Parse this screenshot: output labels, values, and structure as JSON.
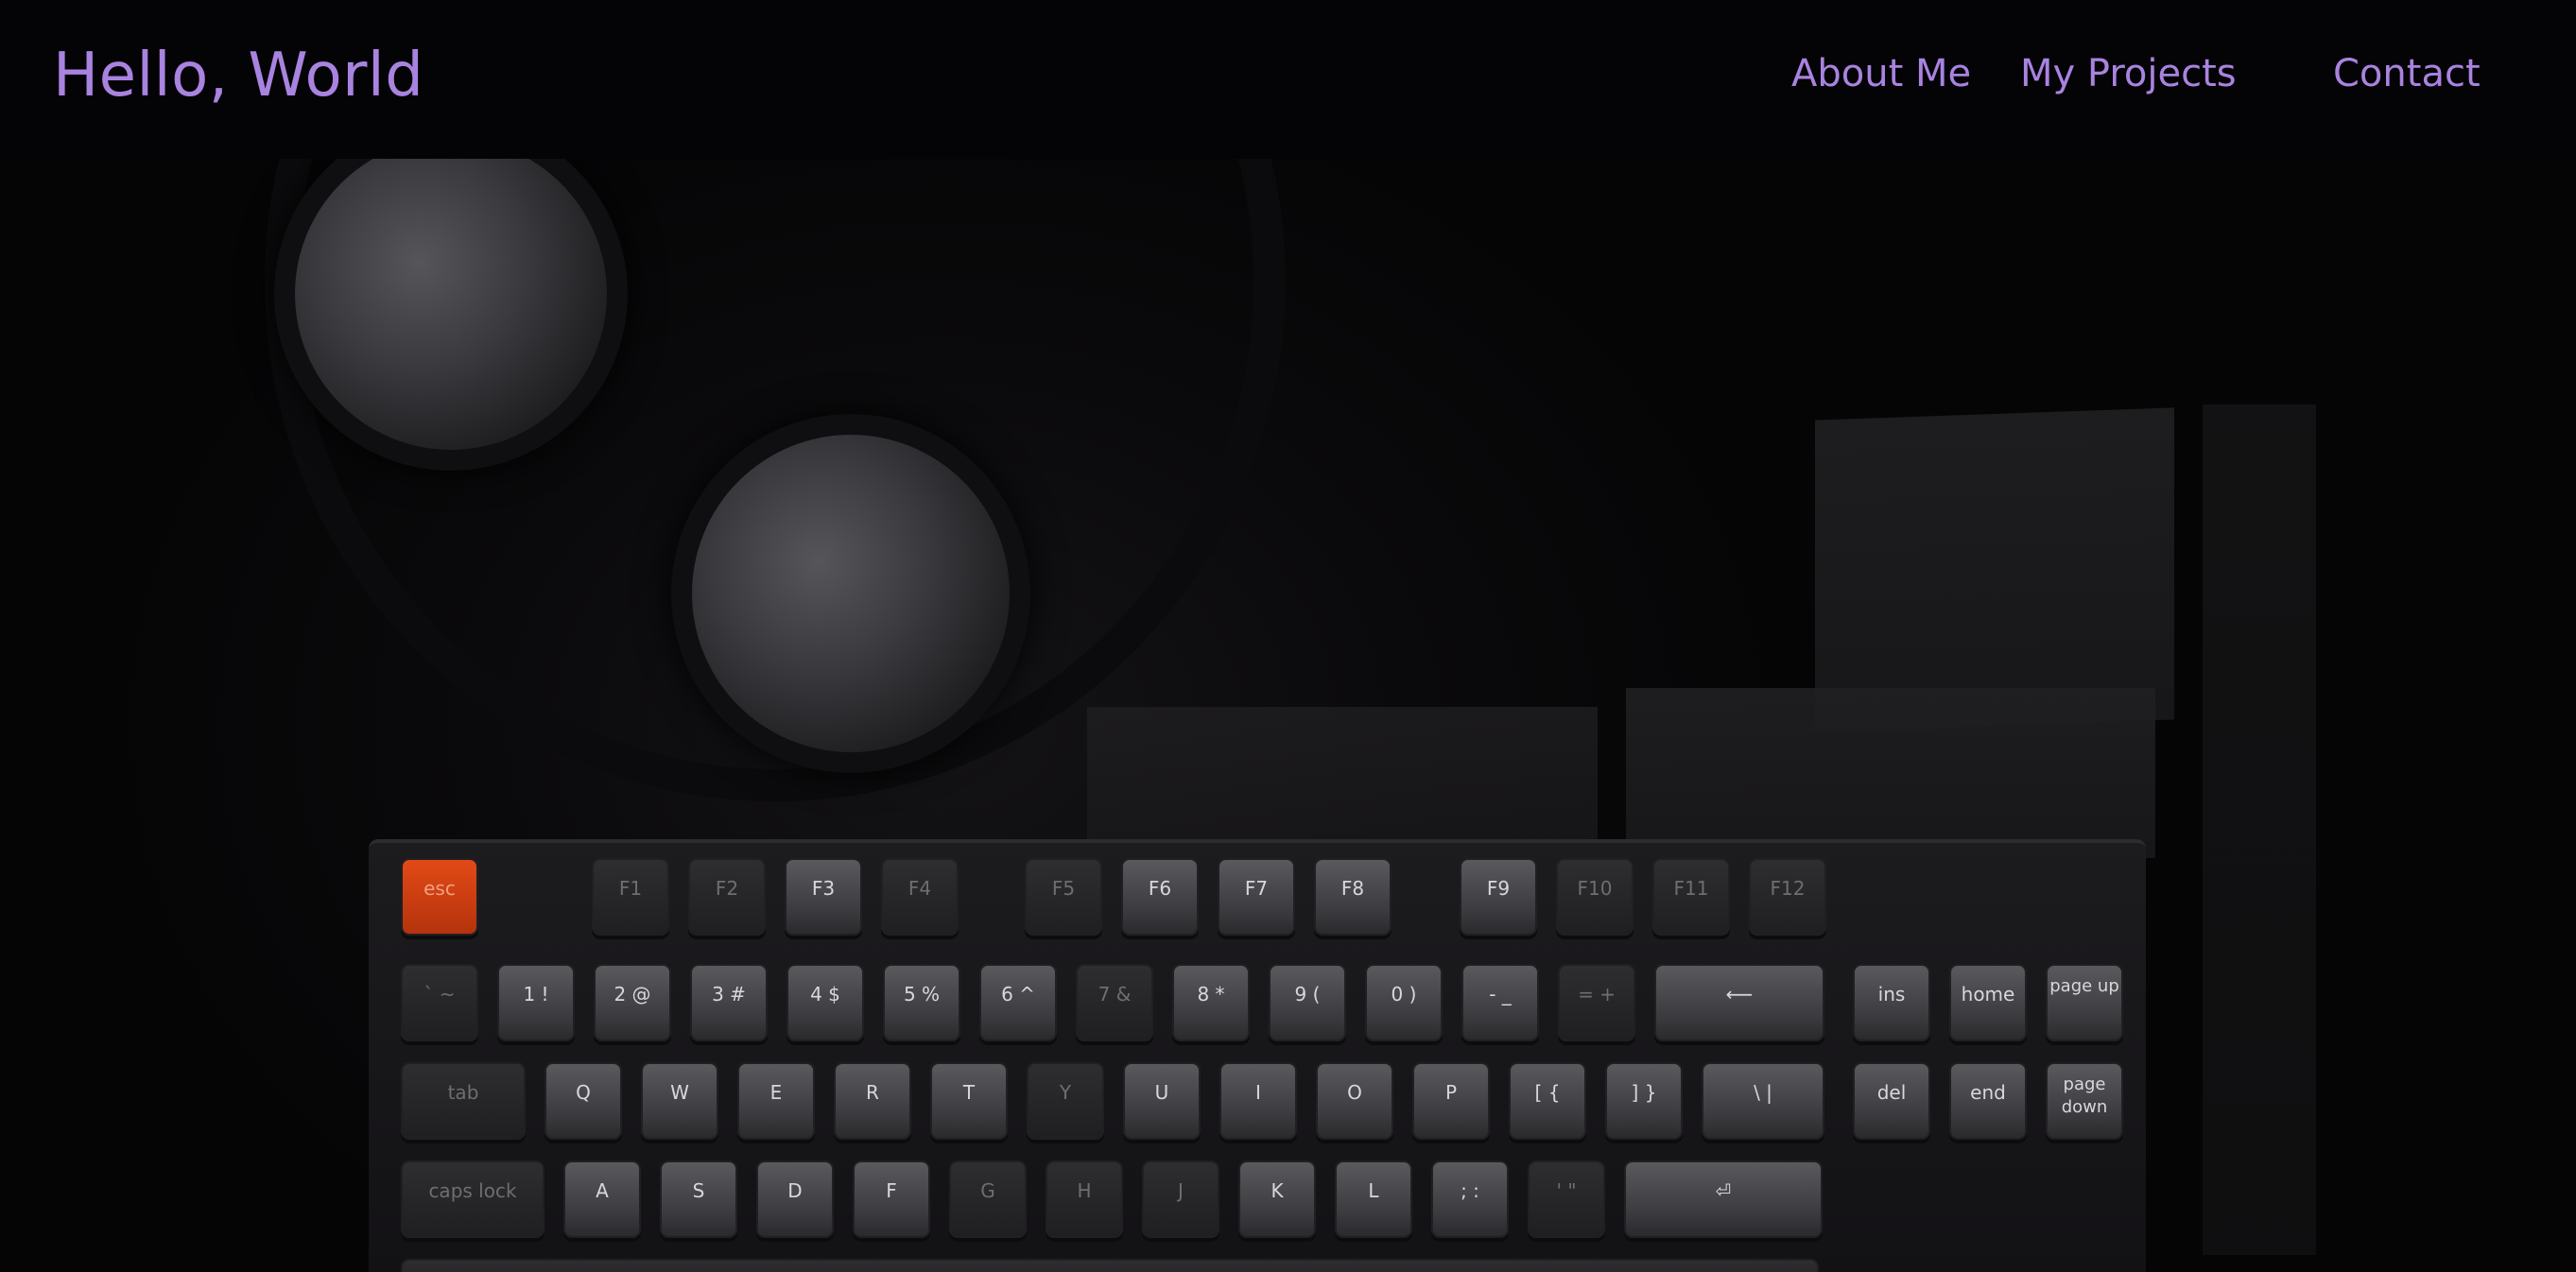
{
  "navbar": {
    "brand": "Hello, World",
    "links": [
      {
        "label": "About Me"
      },
      {
        "label": "My Projects"
      },
      {
        "label": "Contact"
      }
    ]
  },
  "hero": {
    "image_alt": "Dark desk with headphones and mechanical keyboard",
    "keyboard": {
      "function_row": [
        "esc",
        "F1",
        "F2",
        "F3",
        "F4",
        "F5",
        "F6",
        "F7",
        "F8",
        "F9",
        "F10",
        "F11",
        "F12"
      ],
      "number_row": [
        "` ~",
        "1 !",
        "2 @",
        "3 #",
        "4 $",
        "5 %",
        "6 ^",
        "7 &",
        "8 *",
        "9 (",
        "0 )",
        "- _",
        "= +",
        "⟵",
        "ins",
        "home",
        "page up"
      ],
      "top_row": [
        "tab",
        "Q",
        "W",
        "E",
        "R",
        "T",
        "Y",
        "U",
        "I",
        "O",
        "P",
        "[ {",
        "] }",
        "\\ |",
        "del",
        "end",
        "page down"
      ],
      "home_row": [
        "caps lock",
        "A",
        "S",
        "D",
        "F",
        "G",
        "H",
        "J",
        "K",
        "L",
        "; :",
        "' \"",
        "⏎"
      ]
    }
  },
  "colors": {
    "accent": "#a983e0",
    "navbar_bg": "#040305",
    "esc_key": "#e24a17"
  }
}
